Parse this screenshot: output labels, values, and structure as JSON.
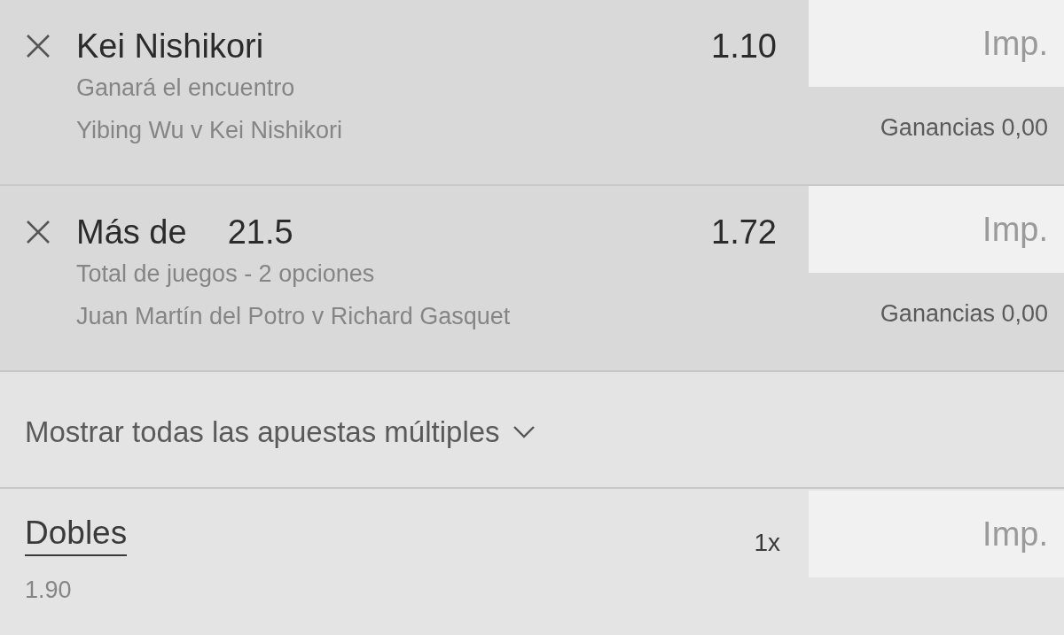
{
  "bets": [
    {
      "selection": "Kei Nishikori",
      "odds": "1.10",
      "market": "Ganará el encuentro",
      "event": "Yibing Wu v Kei Nishikori",
      "stake": {
        "placeholder": "Imp."
      },
      "winnings": "Ganancias 0,00"
    },
    {
      "selection": "Más de",
      "line": "21.5",
      "odds": "1.72",
      "market": "Total de juegos - 2 opciones",
      "event": "Juan Martín del Potro v Richard Gasquet",
      "stake": {
        "placeholder": "Imp."
      },
      "winnings": "Ganancias 0,00"
    }
  ],
  "multiples_toggle": {
    "label": "Mostrar todas las apuestas múltiples",
    "expanded": false
  },
  "combos": [
    {
      "name": "Dobles",
      "multiplier": "1x",
      "odds": "1.90",
      "stake": {
        "placeholder": "Imp."
      }
    }
  ]
}
